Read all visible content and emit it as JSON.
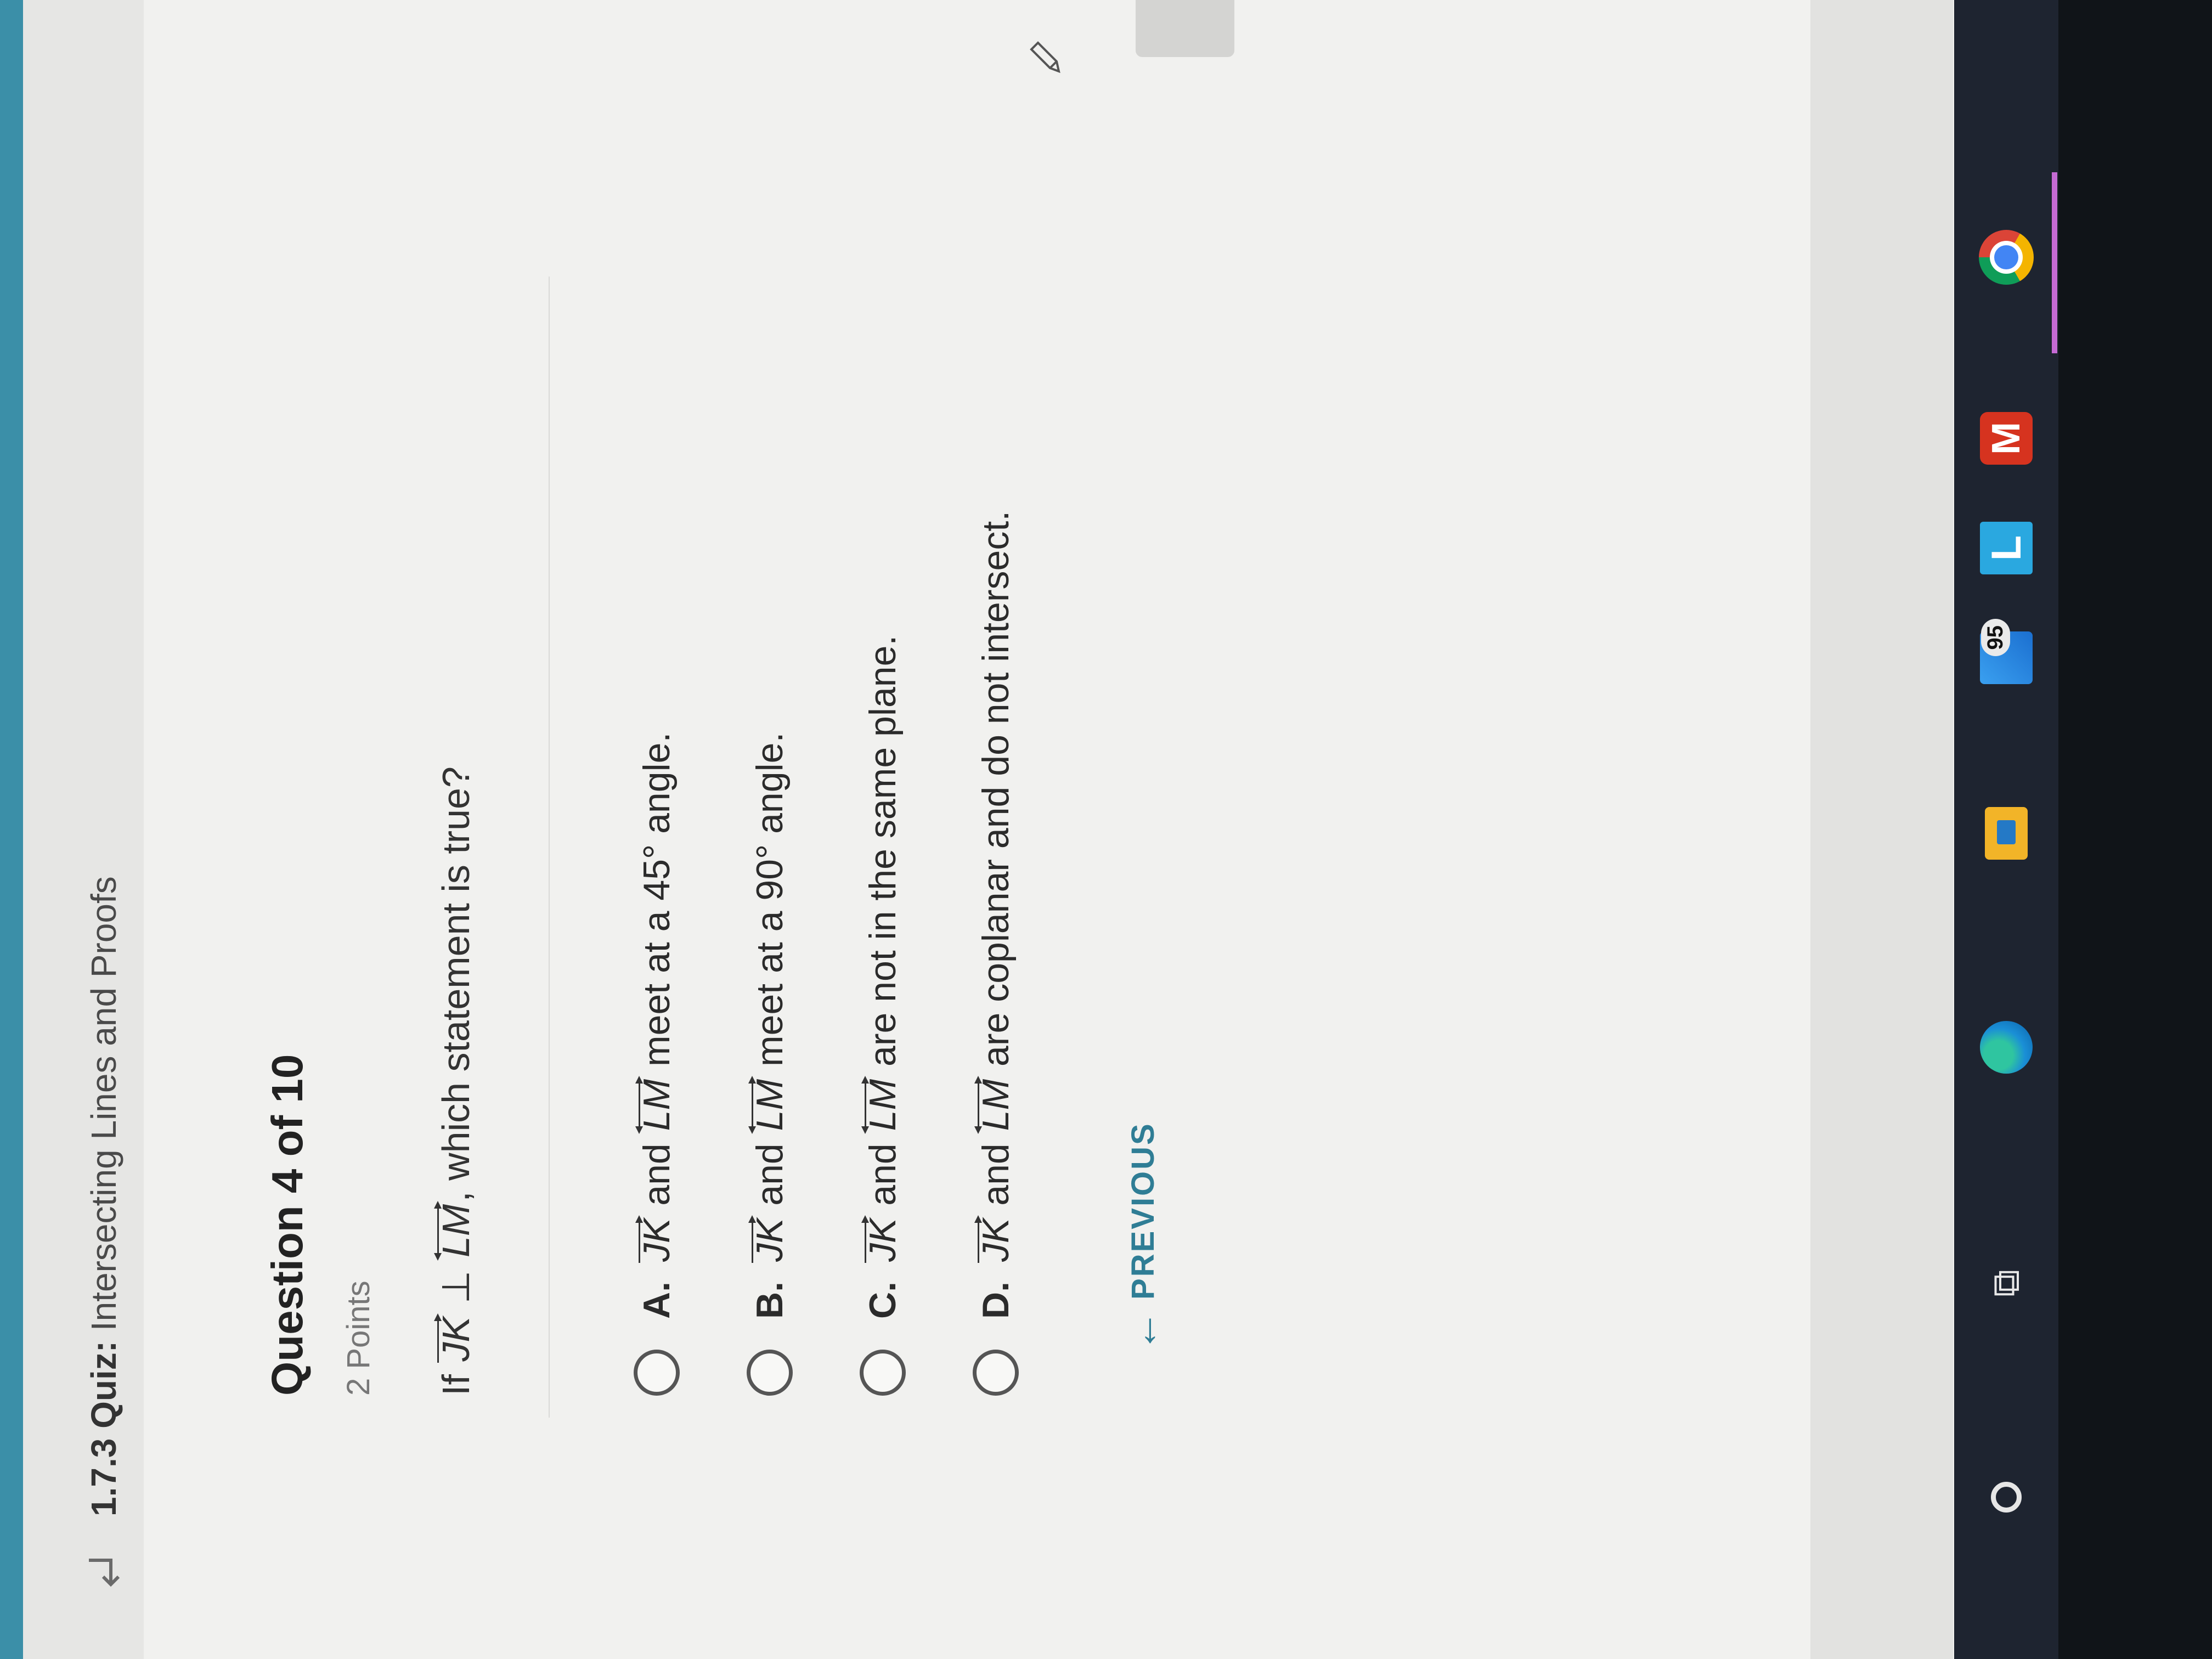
{
  "header": {
    "course_code": "1.7.3",
    "quiz_label": "Quiz:",
    "title": "Intersecting Lines and Proofs"
  },
  "question": {
    "heading": "Question 4 of 10",
    "points": "2 Points",
    "prompt_prefix": "If",
    "segment1": "JK",
    "perp_symbol": "⊥",
    "segment2": "LM",
    "prompt_suffix": ", which statement is true?"
  },
  "options": [
    {
      "letter": "A.",
      "line1": "JK",
      "conj": "and",
      "line2": "LM",
      "text": "meet at a 45° angle."
    },
    {
      "letter": "B.",
      "line1": "JK",
      "conj": "and",
      "line2": "LM",
      "text": "meet at a 90° angle."
    },
    {
      "letter": "C.",
      "line1": "JK",
      "conj": "and",
      "line2": "LM",
      "text": "are not in the same plane."
    },
    {
      "letter": "D.",
      "line1": "JK",
      "conj": "and",
      "line2": "LM",
      "text": "are coplanar and do not intersect."
    }
  ],
  "navigation": {
    "previous_label": "PREVIOUS"
  },
  "taskbar": {
    "mail_badge": "95",
    "l_app_letter": "L",
    "m_app_letter": "M"
  },
  "colors": {
    "accent": "#2f7d95",
    "header_strip": "#3b8fa8",
    "taskbar": "#1e2430"
  }
}
